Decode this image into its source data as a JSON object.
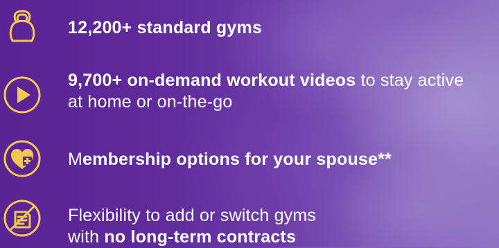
{
  "colors": {
    "icon_gold": "#f2c94c",
    "background_purple": "#5a2396",
    "text": "#ffffff"
  },
  "features": [
    {
      "icon": "kettlebell-icon",
      "bold": "12,200+ standard gyms",
      "rest": ""
    },
    {
      "icon": "play-icon",
      "bold": "9,700+ on-demand workout videos",
      "rest_line1": " to stay active",
      "rest_line2": "at home or on-the-go"
    },
    {
      "icon": "heart-plus-icon",
      "lead": "M",
      "bold": "embership options for your spouse**"
    },
    {
      "icon": "no-contract-icon",
      "line1": "Flexibility to add or switch gyms",
      "line2_prefix": "with ",
      "line2_bold": "no long-term contracts"
    }
  ]
}
